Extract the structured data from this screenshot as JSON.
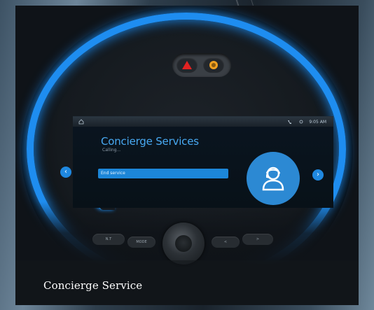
{
  "infotainment": {
    "status_time": "9:05 AM",
    "title": "Concierge Services",
    "subtitle": "Calling...",
    "end_button_label": "End service"
  },
  "console_buttons": [
    "N.T",
    "MODE",
    "<",
    ">"
  ],
  "caption": "Concierge Service",
  "colors": {
    "ring_blue": "#1e8df0",
    "screen_accent": "#48a9f2",
    "hazard_red": "#e22222",
    "hazard_amber": "#f0a020"
  }
}
